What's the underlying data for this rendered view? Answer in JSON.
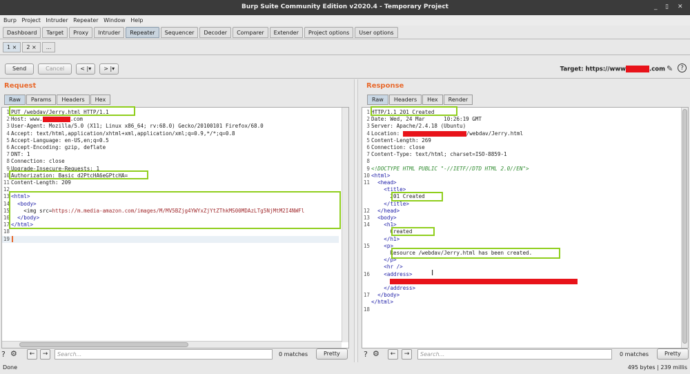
{
  "window": {
    "title": "Burp Suite Community Edition v2020.4 - Temporary Project",
    "min": "_",
    "max": "▯",
    "close": "✕"
  },
  "menu": [
    "Burp",
    "Project",
    "Intruder",
    "Repeater",
    "Window",
    "Help"
  ],
  "main_tabs": [
    "Dashboard",
    "Target",
    "Proxy",
    "Intruder",
    "Repeater",
    "Sequencer",
    "Decoder",
    "Comparer",
    "Extender",
    "Project options",
    "User options"
  ],
  "sub_tabs": [
    "1 ×",
    "2 ×",
    "..."
  ],
  "toolbar": {
    "send": "Send",
    "cancel": "Cancel",
    "back": "< |▾",
    "forward": "> |▾"
  },
  "target": {
    "label": "Target: https://www",
    "suffix": ".com"
  },
  "request": {
    "title": "Request",
    "tabs": [
      "Raw",
      "Params",
      "Headers",
      "Hex"
    ],
    "lines": [
      "PUT /webdav/Jerry.html HTTP/1.1",
      "Host: www.",
      "User-Agent: Mozilla/5.0 (X11; Linux x86_64; rv:68.0) Gecko/20100101 Firefox/68.0",
      "Accept: text/html,application/xhtml+xml,application/xml;q=0.9,*/*;q=0.8",
      "Accept-Language: en-US,en;q=0.5",
      "Accept-Encoding: gzip, deflate",
      "DNT: 1",
      "Connection: close",
      "Upgrade-Insecure-Requests: 1",
      "Authorization: Basic d2PtcHA6eGPtcHA=",
      "Content-Length: 209",
      "",
      "<html>",
      "  <body>",
      "    <img src=https://m.media-amazon.com/images/M/MV5BZjg4YWYxZjYtZThkMS00MDAzLTg5NjMtM2I4NWFl",
      "  </body>",
      "</html>",
      "",
      ""
    ],
    "host_suffix": ".com",
    "search_placeholder": "Search...",
    "matches": "0 matches",
    "pretty": "Pretty"
  },
  "response": {
    "title": "Response",
    "tabs": [
      "Headers",
      "Hex",
      "Render"
    ],
    "raw_tab": "Raw",
    "lines": [
      "HTTP/1.1 201 Created",
      "Date: Wed, 24 Mar      10:26:19 GMT",
      "Server: Apache/2.4.18 (Ubuntu)",
      "Location:",
      "Content-Length: 269",
      "Connection: close",
      "Content-Type: text/html; charset=ISO-8859-1",
      "",
      "<!DOCTYPE HTML PUBLIC \"-//IETF//DTD HTML 2.0//EN\">",
      "<html>",
      "  <head>",
      "    <title>",
      "      201 Created",
      "    </title>",
      "  </head>",
      "  <body>",
      "    <h1>",
      "      Created",
      "    </h1>",
      "    <p>",
      "      Resource /webdav/Jerry.html has been created.",
      "    </p>",
      "    <hr />",
      "    <address>",
      "",
      "    </address>",
      "  </body>",
      "</html>",
      ""
    ],
    "location_suffix": "/webdav/Jerry.html",
    "search_placeholder": "Search...",
    "matches": "0 matches",
    "pretty": "Pretty"
  },
  "status": {
    "left": "Done",
    "right": "495 bytes | 239 millis"
  }
}
